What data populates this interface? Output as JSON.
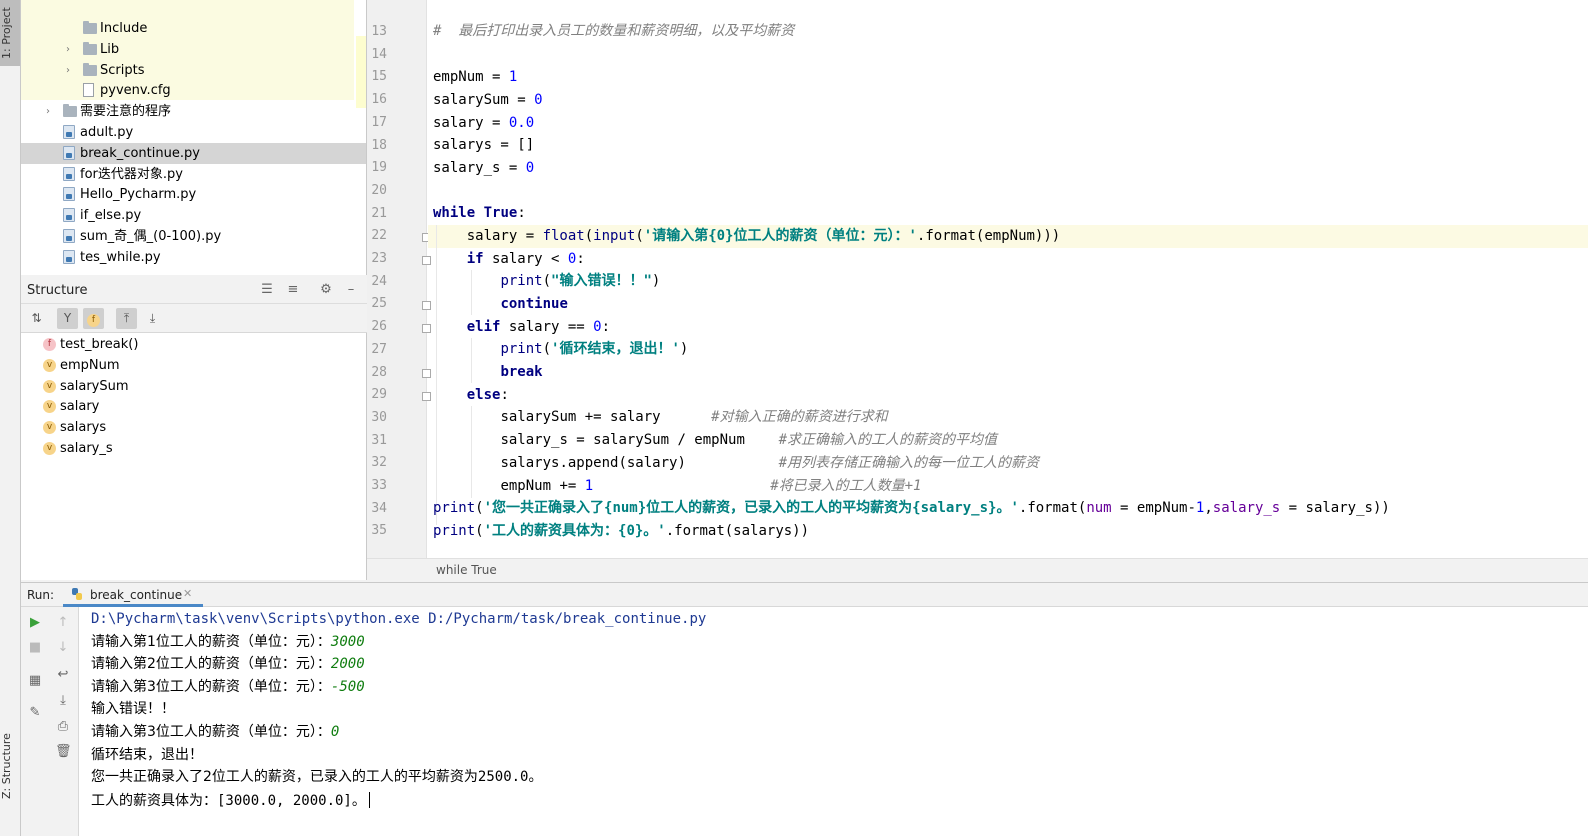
{
  "left_strip": {
    "project_tab": "1: Project",
    "structure_tab": "Z: Structure"
  },
  "project_tree": {
    "items": [
      {
        "label": "Include",
        "type": "folder",
        "indent": 3,
        "arrow": ""
      },
      {
        "label": "Lib",
        "type": "folder",
        "indent": 3,
        "arrow": ">"
      },
      {
        "label": "Scripts",
        "type": "folder",
        "indent": 3,
        "arrow": ">"
      },
      {
        "label": "pyvenv.cfg",
        "type": "cfg",
        "indent": 3,
        "arrow": ""
      },
      {
        "label": "需要注意的程序",
        "type": "folder",
        "indent": 2,
        "arrow": ">"
      },
      {
        "label": "adult.py",
        "type": "py",
        "indent": 2,
        "arrow": ""
      },
      {
        "label": "break_continue.py",
        "type": "py",
        "indent": 2,
        "arrow": "",
        "selected": true
      },
      {
        "label": "for迭代器对象.py",
        "type": "py",
        "indent": 2,
        "arrow": ""
      },
      {
        "label": "Hello_Pycharm.py",
        "type": "py",
        "indent": 2,
        "arrow": ""
      },
      {
        "label": "if_else.py",
        "type": "py",
        "indent": 2,
        "arrow": ""
      },
      {
        "label": "sum_奇_偶_(0-100).py",
        "type": "py",
        "indent": 2,
        "arrow": ""
      },
      {
        "label": "tes_while.py",
        "type": "py",
        "indent": 2,
        "arrow": ""
      }
    ]
  },
  "structure": {
    "title": "Structure",
    "items": [
      {
        "badge": "f",
        "label": "test_break()"
      },
      {
        "badge": "v",
        "label": "empNum"
      },
      {
        "badge": "v",
        "label": "salarySum"
      },
      {
        "badge": "v",
        "label": "salary"
      },
      {
        "badge": "v",
        "label": "salarys"
      },
      {
        "badge": "v",
        "label": "salary_s"
      }
    ]
  },
  "editor": {
    "breadcrumb": "while True",
    "line_numbers": [
      "13",
      "14",
      "15",
      "16",
      "17",
      "18",
      "19",
      "20",
      "21",
      "22",
      "23",
      "24",
      "25",
      "26",
      "27",
      "28",
      "29",
      "30",
      "31",
      "32",
      "33",
      "34",
      "35"
    ],
    "code_text": {
      "l13_cmt": "#  最后打印出录入员工的数量和薪资明细，以及平均薪资",
      "l15": "empNum = ",
      "l15_num": "1",
      "l16": "salarySum = ",
      "l16_num": "0",
      "l17": "salary = ",
      "l17_num": "0.0",
      "l18": "salarys = []",
      "l19": "salary_s = ",
      "l19_num": "0",
      "l21_kw": "while",
      "l21_kw2": "True",
      "l21_end": ":",
      "l22_a": "salary = ",
      "l22_float": "float",
      "l22_b": "(",
      "l22_input": "input",
      "l22_c": "(",
      "l22_str": "'请输入第{0}位工人的薪资（单位：元）：'",
      "l22_d": ".format(empNum)))",
      "l23_kw": "if",
      "l23_a": " salary < ",
      "l23_num": "0",
      "l23_b": ":",
      "l24_print": "print",
      "l24_a": "(",
      "l24_str": "\"输入错误！！\"",
      "l24_b": ")",
      "l25_kw": "continue",
      "l26_kw": "elif",
      "l26_a": " salary == ",
      "l26_num": "0",
      "l26_b": ":",
      "l27_print": "print",
      "l27_a": "(",
      "l27_str": "'循环结束，退出！'",
      "l27_b": ")",
      "l28_kw": "break",
      "l29_kw": "else",
      "l29_a": ":",
      "l30": "salarySum += salary      ",
      "l30_cmt": "#对输入正确的薪资进行求和",
      "l31": "salary_s = salarySum / empNum    ",
      "l31_cmt": "#求正确输入的工人的薪资的平均值",
      "l32": "salarys.append(salary)           ",
      "l32_cmt": "#用列表存储正确输入的每一位工人的薪资",
      "l33": "empNum += ",
      "l33_num": "1",
      "l33_pad": "                     ",
      "l33_cmt": "#将已录入的工人数量+1",
      "l34_print": "print",
      "l34_a": "(",
      "l34_str": "'您一共正确录入了{num}位工人的薪资，已录入的工人的平均薪资为{salary_s}。'",
      "l34_b": ".format(",
      "l34_kw1": "num",
      "l34_c": " = empNum-",
      "l34_num": "1",
      "l34_d": ",",
      "l34_kw2": "salary_s",
      "l34_e": " = salary_s))",
      "l35_print": "print",
      "l35_a": "(",
      "l35_str": "'工人的薪资具体为：{0}。'",
      "l35_b": ".format(salarys))"
    }
  },
  "run": {
    "label": "Run:",
    "tab": "break_continue",
    "console": {
      "cmd": "D:\\Pycharm\\task\\venv\\Scripts\\python.exe D:/Pycharm/task/break_continue.py",
      "p1": "请输入第1位工人的薪资（单位：元）：",
      "v1": "3000",
      "p2": "请输入第2位工人的薪资（单位：元）：",
      "v2": "2000",
      "p3": "请输入第3位工人的薪资（单位：元）：",
      "v3": "-500",
      "err": "输入错误！！",
      "p4": "请输入第3位工人的薪资（单位：元）：",
      "v4": "0",
      "end": "循环结束，退出！",
      "sum_a": "您一共正确录入了2位工人的薪资，已录入的工人的平均薪资为",
      "sum_b": "2500.0",
      "sum_c": "。",
      "list_a": "工人的薪资具体为：",
      "list_b": "[3000.0, 2000.0]",
      "list_c": "。"
    }
  }
}
